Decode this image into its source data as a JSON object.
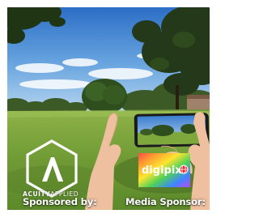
{
  "banner": {
    "acuity_brand_bold": "ACUITY",
    "acuity_brand_light": "APPLIED",
    "digipix_brand": "digipix",
    "sponsored_by_label": "Sponsored by:",
    "media_sponsor_label": "Media Sponsor:"
  },
  "colors": {
    "sky_top": "#2f73c9",
    "sky_bottom": "#9cc6ea",
    "grass": "#7fa83c",
    "tree_dark": "#2f4a1c",
    "skin": "#f3c6a8",
    "phone_frame": "#1b1b1b"
  },
  "icons": {
    "acuity_logo": "hexagon-a-logo-icon",
    "digipix_logo": "digipix-rainbow-logo-icon",
    "globe": "globe-icon"
  }
}
